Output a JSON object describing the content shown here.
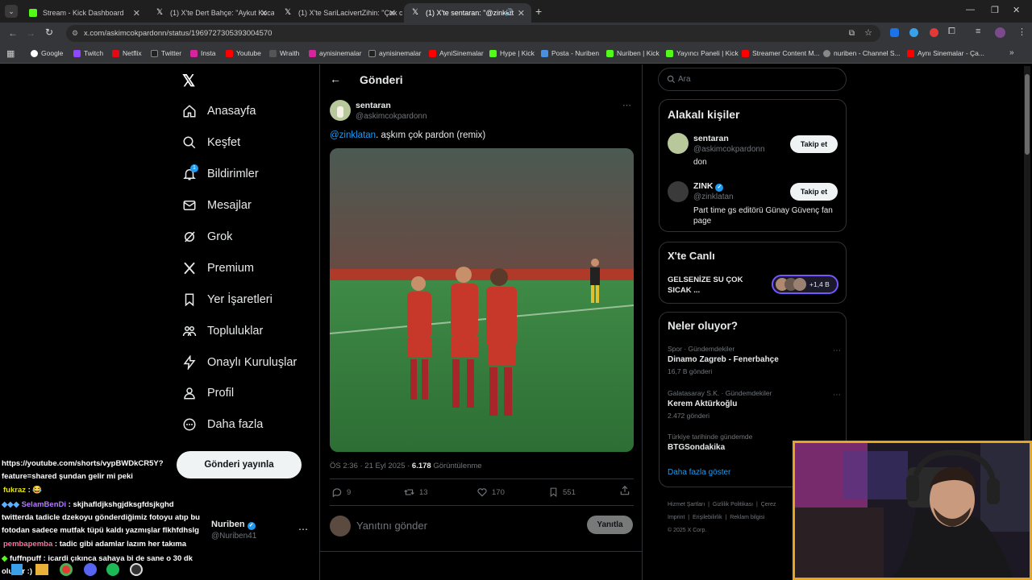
{
  "tabs": [
    {
      "title": "Stream - Kick Dashboard",
      "icon": "kick-icon",
      "active": false
    },
    {
      "title": "(1) X'te Dert Bahçe: \"Aykut Koca",
      "icon": "x-icon",
      "active": false
    },
    {
      "title": "(1) X'te SariLacivertZihin: \"Çok c",
      "icon": "x-icon",
      "active": false
    },
    {
      "title": "(1) X'te sentaran: \"@zinklat",
      "icon": "x-icon",
      "active": true
    }
  ],
  "url": "x.com/askimcokpardonn/status/1969727305393004570",
  "bookmarks": [
    "Google",
    "Twitch",
    "Netflix",
    "Twitter",
    "Insta",
    "Youtube",
    "Wraith",
    "aynisinemalar",
    "aynisinemalar",
    "AyniSinemalar",
    "Hype | Kick",
    "Posta - Nuriben",
    "Nuriben | Kick",
    "Yayıncı Paneli | Kick",
    "Streamer Content M...",
    "nuriben - Channel S...",
    "Aynı Sinemalar - Ça..."
  ],
  "nav": {
    "items": [
      "Anasayfa",
      "Keşfet",
      "Bildirimler",
      "Mesajlar",
      "Grok",
      "Premium",
      "Yer İşaretleri",
      "Topluluklar",
      "Onaylı Kuruluşlar",
      "Profil",
      "Daha fazla"
    ],
    "notif_badge": "1",
    "post_button": "Gönderi yayınla"
  },
  "account": {
    "name": "Nuriben",
    "handle": "@Nuriben41"
  },
  "header": {
    "title": "Gönderi"
  },
  "tweet": {
    "author": "sentaran",
    "handle": "@askimcokpardonn",
    "mention": "@zinklatan",
    "text": ". aşkım çok pardon (remix)",
    "time": "ÖS 2:36 · 21 Eyl 2025 · ",
    "views": "6.178",
    "views_label": " Görüntülenme",
    "replies": "9",
    "retweets": "13",
    "likes": "170",
    "bookmarks": "551",
    "reply_placeholder": "Yanıtını gönder",
    "reply_button": "Yanıtla"
  },
  "search": {
    "placeholder": "Ara"
  },
  "related": {
    "title": "Alakalı kişiler",
    "people": [
      {
        "name": "sentaran",
        "handle": "@askimcokpardonn",
        "bio": "don",
        "button": "Takip et"
      },
      {
        "name": "ZINK",
        "handle": "@zinklatan",
        "bio": "Part time gs editörü Günay Güvenç fan page",
        "button": "Takip et"
      }
    ]
  },
  "live": {
    "title": "X'te Canlı",
    "text": "GELSENİZE SU ÇOK SICAK ...",
    "count": "+1,4 B"
  },
  "trends": {
    "title": "Neler oluyor?",
    "items": [
      {
        "meta": "Spor · Gündemdekiler",
        "name": "Dinamo Zagreb - Fenerbahçe",
        "count": "16,7 B gönderi"
      },
      {
        "meta": "Galatasaray S.K. · Gündemdekiler",
        "name": "Kerem Aktürkoğlu",
        "count": "2.472 gönderi"
      },
      {
        "meta": "Türkiye tarihinde gündemde",
        "name": "BTGSondakika",
        "count": ""
      }
    ],
    "more": "Daha fazla göster"
  },
  "footer": {
    "links": [
      "Hizmet Şartları",
      "Gizlilik Politikası",
      "Çerez",
      "Imprint",
      "Erişilebilirlik",
      "Reklam bilgisi"
    ],
    "copyright": "© 2025 X Corp."
  },
  "chat": [
    {
      "user": "",
      "text": "https://youtube.com/shorts/vypBWDkCR5Y?"
    },
    {
      "user": "",
      "text": "feature=shared şundan gelir mi peki"
    },
    {
      "user": "fukraz",
      "text": " : 😂"
    },
    {
      "user": "SelamBenDi",
      "text": " : skjhafldjkshgjdksgfdsjkghd"
    },
    {
      "user": "",
      "text": "twitterda tadicle dzekoyu gönderdiğimiz fotoyu atıp bu"
    },
    {
      "user": "",
      "text": "fotodan sadece mutfak tüpü kaldı yazmışlar flkhfdhslg"
    },
    {
      "user": "pembapemba",
      "text": " : tadic gibi adamlar lazım her takıma"
    },
    {
      "user": "fuffnpuff",
      "text": " : icardi çıkınca sahaya bi de sane o 30 dk"
    },
    {
      "user": "",
      "text": "oluyor :)"
    }
  ],
  "colors": {
    "accent": "#1d9bf0",
    "tab_bg": "#1f1f1f",
    "cam_border": "#e6a520",
    "pitch": "#3a8a3c"
  }
}
